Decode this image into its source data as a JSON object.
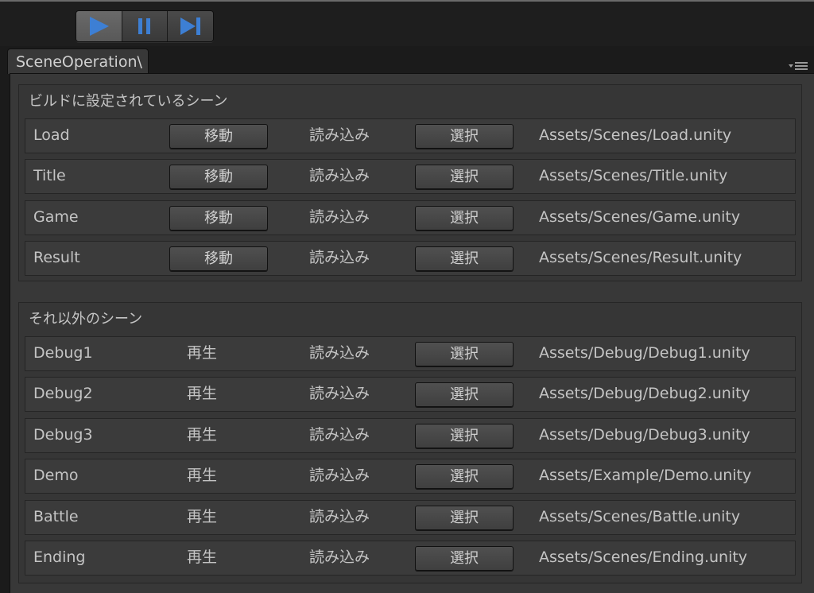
{
  "tab": {
    "title": "SceneOperation\\"
  },
  "toolbar": {
    "play_icon": "play-icon",
    "pause_icon": "pause-icon",
    "step_icon": "step-icon",
    "accent": "#3d7fd4"
  },
  "build_group": {
    "title": "ビルドに設定されているシーン",
    "rows": [
      {
        "name": "Load",
        "action": "移動",
        "load": "読み込み",
        "select": "選択",
        "path": "Assets/Scenes/Load.unity"
      },
      {
        "name": "Title",
        "action": "移動",
        "load": "読み込み",
        "select": "選択",
        "path": "Assets/Scenes/Title.unity"
      },
      {
        "name": "Game",
        "action": "移動",
        "load": "読み込み",
        "select": "選択",
        "path": "Assets/Scenes/Game.unity"
      },
      {
        "name": "Result",
        "action": "移動",
        "load": "読み込み",
        "select": "選択",
        "path": "Assets/Scenes/Result.unity"
      }
    ]
  },
  "other_group": {
    "title": "それ以外のシーン",
    "rows": [
      {
        "name": "Debug1",
        "action": "再生",
        "load": "読み込み",
        "select": "選択",
        "path": "Assets/Debug/Debug1.unity"
      },
      {
        "name": "Debug2",
        "action": "再生",
        "load": "読み込み",
        "select": "選択",
        "path": "Assets/Debug/Debug2.unity"
      },
      {
        "name": "Debug3",
        "action": "再生",
        "load": "読み込み",
        "select": "選択",
        "path": "Assets/Debug/Debug3.unity"
      },
      {
        "name": "Demo",
        "action": "再生",
        "load": "読み込み",
        "select": "選択",
        "path": "Assets/Example/Demo.unity"
      },
      {
        "name": "Battle",
        "action": "再生",
        "load": "読み込み",
        "select": "選択",
        "path": "Assets/Scenes/Battle.unity"
      },
      {
        "name": "Ending",
        "action": "再生",
        "load": "読み込み",
        "select": "選択",
        "path": "Assets/Scenes/Ending.unity"
      }
    ]
  }
}
